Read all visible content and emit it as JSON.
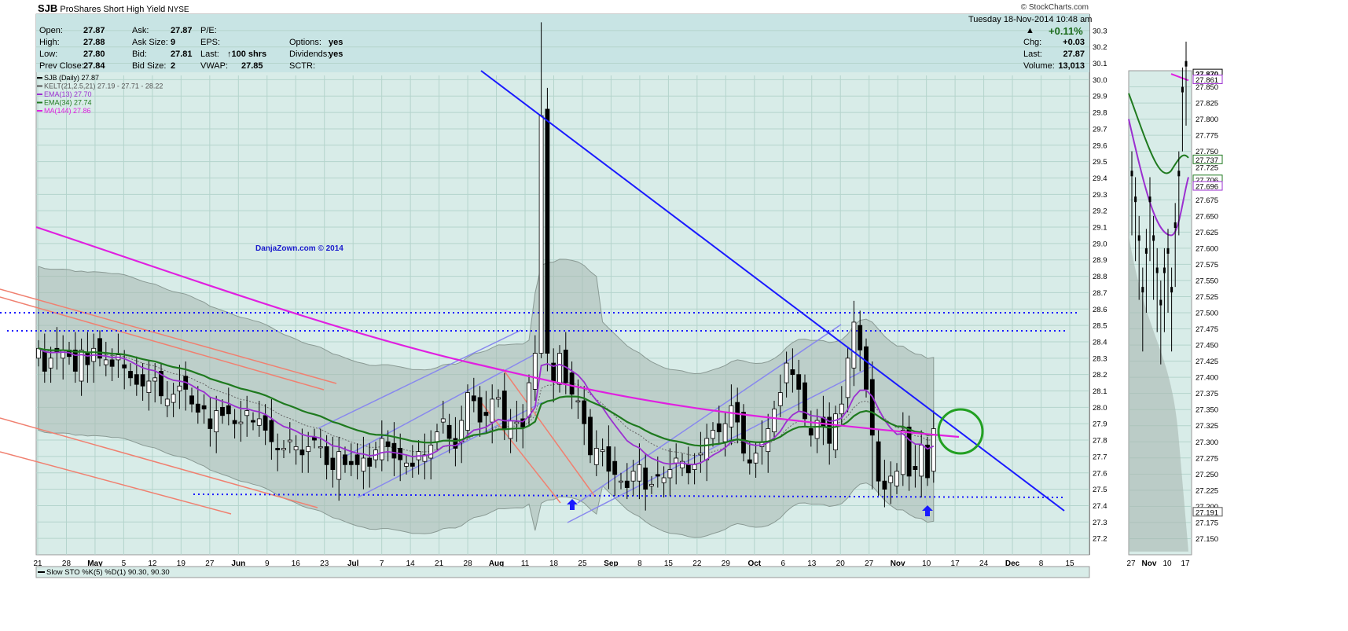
{
  "header": {
    "symbol": "SJB",
    "name": "ProShares Short High Yield",
    "exchange": "NYSE",
    "source": "© StockCharts.com",
    "datetime": "Tuesday 18-Nov-2014 10:48 am"
  },
  "quote": {
    "left_labels": [
      "Open:",
      "High:",
      "Low:",
      "Prev Close:"
    ],
    "left_values": [
      "27.87",
      "27.88",
      "27.80",
      "27.84"
    ],
    "mid_labels": [
      "Ask:",
      "Ask Size:",
      "Bid:",
      "Bid Size:"
    ],
    "mid_values": [
      "27.87",
      "9",
      "27.81",
      "2"
    ],
    "right_labels": [
      "P/E:",
      "EPS:",
      "Last:",
      "VWAP:"
    ],
    "right_values": [
      "",
      "",
      "100 shrs",
      "27.85"
    ],
    "opt_labels": [
      "Options:",
      "Dividends:",
      "SCTR:"
    ],
    "opt_values": [
      "yes",
      "yes",
      ""
    ],
    "change_pct": "+0.11%",
    "summary_labels": [
      "Chg:",
      "Last:",
      "Volume:"
    ],
    "summary_values": [
      "+0.03",
      "27.87",
      "13,013"
    ]
  },
  "legend": [
    {
      "text": "SJB (Daily) 27.87",
      "color": "#000000"
    },
    {
      "text": "KELT(21,2.5,21) 27.19 - 27.71 - 28.22",
      "color": "#555555"
    },
    {
      "text": "EMA(13) 27.70",
      "color": "#9b30d0"
    },
    {
      "text": "EMA(34) 27.74",
      "color": "#1f7a1f"
    },
    {
      "text": "MA(144) 27.86",
      "color": "#e020e0"
    }
  ],
  "watermark": "DanjaZown.com © 2014",
  "indicator_label": "Slow STO %K(5) %D(1) 90.30, 90.30",
  "colors": {
    "panel_bg": "#d8ece8",
    "ema13": "#9b30d0",
    "ema34": "#1f7a1f",
    "ma144": "#e020e0",
    "trend_blue": "#1a1aff",
    "channel": "#8888ee",
    "salmon": "#f08070",
    "circle": "#22a022"
  },
  "chart_data": {
    "type": "candlestick",
    "y_ticks": [
      30.3,
      30.2,
      30.1,
      30.0,
      29.9,
      29.8,
      29.7,
      29.6,
      29.5,
      29.4,
      29.3,
      29.2,
      29.1,
      29.0,
      28.9,
      28.8,
      28.7,
      28.6,
      28.5,
      28.4,
      28.3,
      28.2,
      28.1,
      28.0,
      27.9,
      27.8,
      27.7,
      27.6,
      27.5,
      27.4,
      27.3,
      27.2
    ],
    "ylim": [
      27.1,
      30.4
    ],
    "x_tick_labels": [
      "21",
      "28",
      "May",
      "5",
      "12",
      "19",
      "27",
      "Jun",
      "9",
      "16",
      "23",
      "Jul",
      "7",
      "14",
      "21",
      "28",
      "Aug",
      "11",
      "18",
      "25",
      "Sep",
      "8",
      "15",
      "22",
      "29",
      "Oct",
      "6",
      "13",
      "20",
      "27",
      "Nov",
      "10",
      "17",
      "24",
      "Dec",
      "8",
      "15"
    ],
    "x_tick_bold": [
      "May",
      "Jun",
      "Jul",
      "Aug",
      "Sep",
      "Oct",
      "Nov",
      "Dec"
    ],
    "n_bars": 147,
    "ohlc_close": [
      28.36,
      28.22,
      28.3,
      28.34,
      28.35,
      28.31,
      28.22,
      28.35,
      28.26,
      28.36,
      28.3,
      28.29,
      28.25,
      28.32,
      28.24,
      28.18,
      28.14,
      28.13,
      28.16,
      28.18,
      28.07,
      28.05,
      28.08,
      28.13,
      28.11,
      28.02,
      27.97,
      27.99,
      27.87,
      27.98,
      27.95,
      27.96,
      27.9,
      27.91,
      27.98,
      27.91,
      27.93,
      27.86,
      27.79,
      27.74,
      27.75,
      27.8,
      27.76,
      27.71,
      27.76,
      27.8,
      27.76,
      27.65,
      27.62,
      27.73,
      27.65,
      27.65,
      27.65,
      27.69,
      27.64,
      27.74,
      27.81,
      27.76,
      27.69,
      27.68,
      27.66,
      27.64,
      27.73,
      27.71,
      27.77,
      27.85,
      27.93,
      27.81,
      27.75,
      27.92,
      28.09,
      28.04,
      27.91,
      27.95,
      28.05,
      28.06,
      27.87,
      27.92,
      27.91,
      27.88,
      28.15,
      28.33,
      29.78,
      28.33,
      28.16,
      28.33,
      28.15,
      28.08,
      28.04,
      27.9,
      27.71,
      27.75,
      27.74,
      27.61,
      27.59,
      27.55,
      27.51,
      27.61,
      27.65,
      27.5,
      27.53,
      27.58,
      27.57,
      27.62,
      27.69,
      27.67,
      27.6,
      27.65,
      27.72,
      27.81,
      27.86,
      27.85,
      27.9,
      28.01,
      27.91,
      27.72,
      27.66,
      27.72,
      27.79,
      27.87,
      27.99,
      28.09,
      28.27,
      28.2,
      28.11,
      27.93,
      27.83,
      27.92,
      27.88,
      27.78,
      27.96,
      28.02,
      28.3,
      28.52,
      28.35,
      28.11,
      27.83,
      27.55,
      27.5,
      27.58,
      27.61,
      27.86,
      27.58,
      27.62,
      27.77,
      27.57,
      27.87
    ],
    "series_names": [
      "SJB (Daily)",
      "KELT(21,2.5,21)",
      "EMA(13)",
      "EMA(34)",
      "MA(144)"
    ],
    "last_price": 27.87,
    "ema13_last": 27.7,
    "ema34_last": 27.74,
    "ma144_last": 27.86,
    "kelt_upper": 28.22,
    "kelt_mid": 27.71,
    "kelt_lower": 27.19,
    "support_levels": [
      27.5
    ],
    "resistance_levels": [
      28.71,
      28.58
    ],
    "side_panel": {
      "x_tick_labels": [
        "27",
        "Nov",
        "10",
        "17"
      ],
      "y_ticks": [
        27.15,
        27.175,
        27.2,
        27.225,
        27.25,
        27.275,
        27.3,
        27.325,
        27.35,
        27.375,
        27.4,
        27.425,
        27.45,
        27.475,
        27.5,
        27.525,
        27.55,
        27.575,
        27.6,
        27.625,
        27.65,
        27.675,
        27.7,
        27.725,
        27.75,
        27.775,
        27.8,
        27.825,
        27.85
      ],
      "y_tick_labels": [
        "27.150",
        "27.175",
        "27.200",
        "27.225",
        "27.250",
        "27.275",
        "27.300",
        "27.325",
        "27.350",
        "27.375",
        "27.400",
        "27.425",
        "27.450",
        "27.475",
        "27.500",
        "27.525",
        "27.550",
        "27.575",
        "27.600",
        "27.625",
        "27.650",
        "27.675",
        "27.700",
        "27.725",
        "27.750",
        "27.775",
        "27.800",
        "27.825",
        "27.850"
      ],
      "ylim": [
        27.125,
        27.875
      ],
      "price_tags": [
        "27.870",
        "27.861",
        "27.737",
        "27.706",
        "27.696",
        "27.191"
      ],
      "price_tag_values": [
        27.87,
        27.861,
        27.737,
        27.706,
        27.696,
        27.191
      ]
    }
  }
}
